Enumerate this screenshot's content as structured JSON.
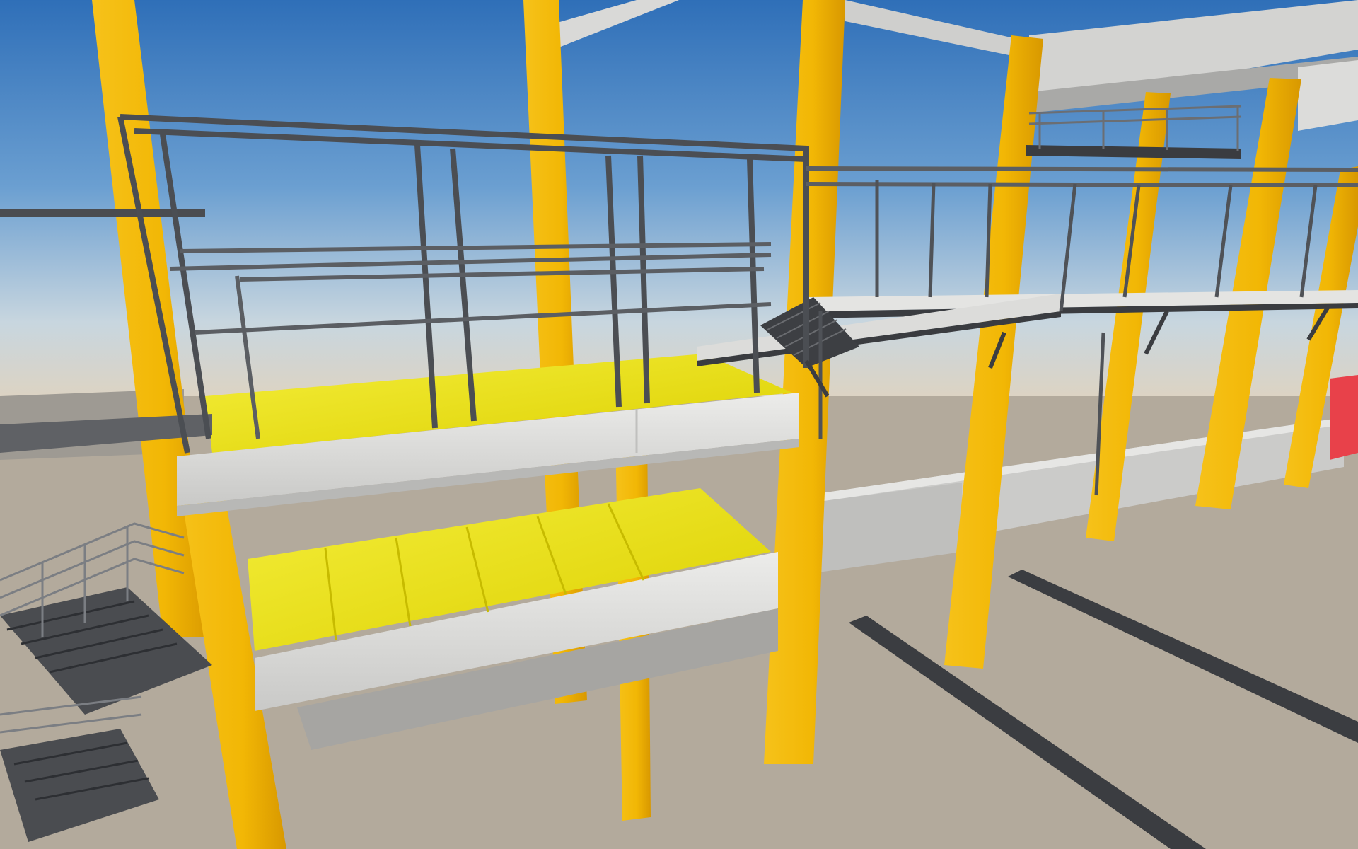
{
  "viewport": {
    "mode": "3d-structural-model",
    "ui_text": []
  },
  "colors": {
    "sky_top": "#2f6fb8",
    "sky_mid": "#9fc1dd",
    "horizon": "#dcd2c2",
    "ground": "#b4ab9d",
    "column_yellow": "#f2b705",
    "column_shadow": "#d99a00",
    "floor_yellow": "#e8dc00",
    "floor_yellow_light": "#f3ee4a",
    "concrete": "#e2e2e0",
    "concrete_shadow": "#a9a9a7",
    "steel_dark": "#3d3f44",
    "steel_mid": "#5b5e63",
    "rail": "#6e7176",
    "stair": "#4a4c50",
    "accent_red": "#e8414a"
  },
  "scene_objects": [
    {
      "type": "column",
      "label": "left-front-column"
    },
    {
      "type": "column",
      "label": "left-mid-column"
    },
    {
      "type": "column",
      "label": "center-column"
    },
    {
      "type": "column",
      "label": "right-columns"
    },
    {
      "type": "platform",
      "label": "upper-yellow-deck"
    },
    {
      "type": "platform",
      "label": "lower-yellow-deck"
    },
    {
      "type": "walkway",
      "label": "right-steel-walkway"
    },
    {
      "type": "stair",
      "label": "left-stairs"
    },
    {
      "type": "rail",
      "label": "floor-rails"
    }
  ]
}
